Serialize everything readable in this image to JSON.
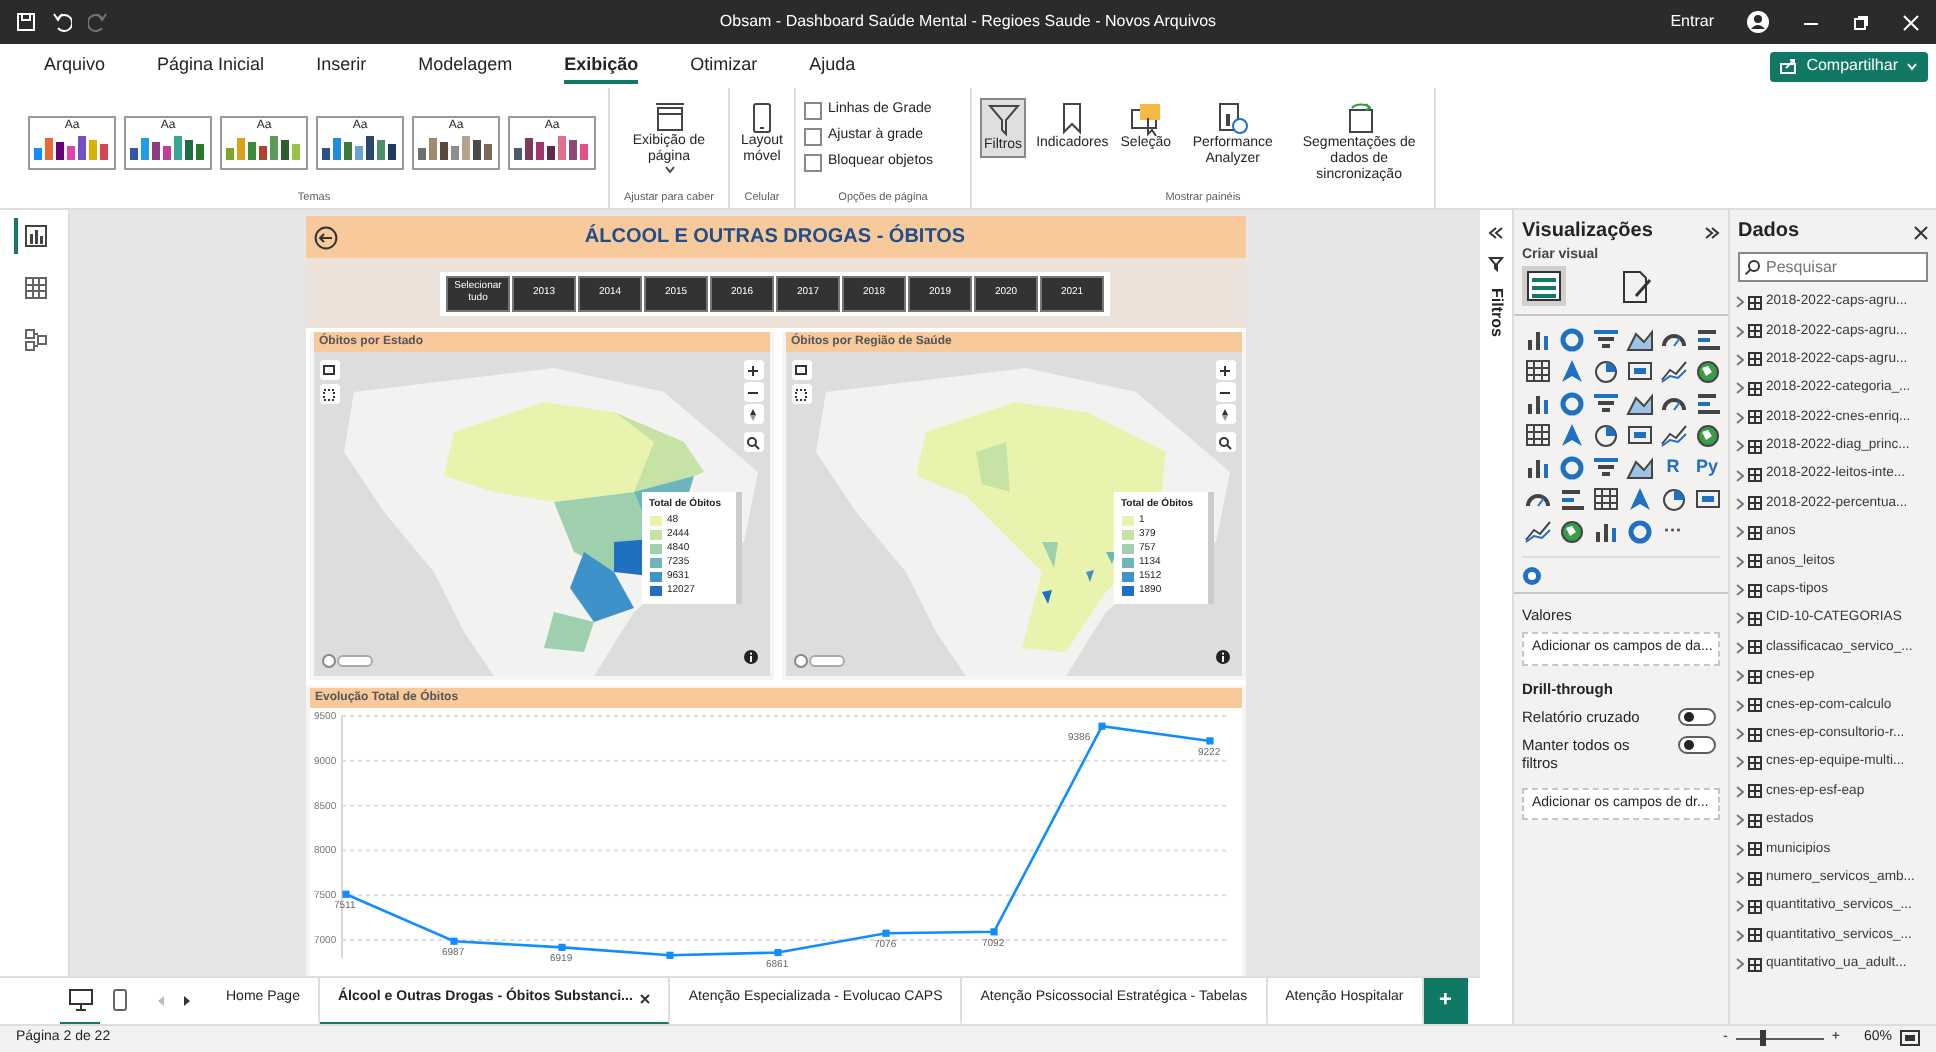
{
  "window": {
    "title": "Obsam - Dashboard Saúde Mental - Regioes Saude - Novos Arquivos",
    "sign_in": "Entrar"
  },
  "ribbon": {
    "tabs": [
      {
        "label": "Arquivo",
        "selected": false
      },
      {
        "label": "Página Inicial",
        "selected": false
      },
      {
        "label": "Inserir",
        "selected": false
      },
      {
        "label": "Modelagem",
        "selected": false
      },
      {
        "label": "Exibição",
        "selected": true
      },
      {
        "label": "Otimizar",
        "selected": false
      },
      {
        "label": "Ajuda",
        "selected": false
      }
    ],
    "share_button": "Compartilhar",
    "themes": {
      "group_label": "Temas",
      "items": [
        {
          "label": "Aa",
          "bars": [
            {
              "color": "#118dff"
            },
            {
              "color": "#e66c37"
            },
            {
              "color": "#6b007b"
            },
            {
              "color": "#e044a7"
            },
            {
              "color": "#744ec2"
            },
            {
              "color": "#d9b300"
            },
            {
              "color": "#d64550"
            }
          ]
        },
        {
          "label": "Aa",
          "bars": [
            {
              "color": "#3257a8"
            },
            {
              "color": "#1f9ce8"
            },
            {
              "color": "#8b3d88"
            },
            {
              "color": "#c23c96"
            },
            {
              "color": "#37a794"
            },
            {
              "color": "#1d6f3f"
            },
            {
              "color": "#2b7a2b"
            }
          ]
        },
        {
          "label": "Aa",
          "bars": [
            {
              "color": "#7aa629"
            },
            {
              "color": "#d9a21b"
            },
            {
              "color": "#3b8c3b"
            },
            {
              "color": "#b04030"
            },
            {
              "color": "#5a9a5a"
            },
            {
              "color": "#2d5f2d"
            },
            {
              "color": "#9ac14a"
            }
          ]
        },
        {
          "label": "Aa",
          "bars": [
            {
              "color": "#2a4f8a"
            },
            {
              "color": "#1f8ce0"
            },
            {
              "color": "#3e7a3e"
            },
            {
              "color": "#68a0d8"
            },
            {
              "color": "#29466b"
            },
            {
              "color": "#4a8f6a"
            },
            {
              "color": "#1b3b5f"
            }
          ]
        },
        {
          "label": "Aa",
          "bars": [
            {
              "color": "#6f6f6f"
            },
            {
              "color": "#a0886e"
            },
            {
              "color": "#5b4a3c"
            },
            {
              "color": "#8e8e8e"
            },
            {
              "color": "#b7a28c"
            },
            {
              "color": "#4a4a4a"
            },
            {
              "color": "#7b6a5a"
            }
          ]
        },
        {
          "label": "Aa",
          "bars": [
            {
              "color": "#4a5b6e"
            },
            {
              "color": "#7a3b5e"
            },
            {
              "color": "#a3356e"
            },
            {
              "color": "#5c2a4a"
            },
            {
              "color": "#e07090"
            },
            {
              "color": "#8a4a7a"
            },
            {
              "color": "#e0508a"
            }
          ]
        }
      ]
    },
    "page_view": {
      "label": "Exibição de página",
      "group_label": "Ajustar para caber"
    },
    "mobile": {
      "label": "Layout móvel",
      "group_label": "Celular"
    },
    "page_options": {
      "group_label": "Opções de página",
      "items": [
        {
          "label": "Linhas de Grade",
          "checked": false
        },
        {
          "label": "Ajustar à grade",
          "checked": false
        },
        {
          "label": "Bloquear objetos",
          "checked": false
        }
      ]
    },
    "panels": {
      "group_label": "Mostrar painéis",
      "items": [
        {
          "label": "Filtros",
          "selected": true
        },
        {
          "label": "Indicadores",
          "selected": false
        },
        {
          "label": "Seleção",
          "selected": false
        },
        {
          "label": "Performance Analyzer",
          "selected": false
        },
        {
          "label": "Segmentações de dados de sincronização",
          "selected": false
        }
      ]
    }
  },
  "left_rail": {
    "views": [
      {
        "selected": true
      },
      {
        "selected": false
      },
      {
        "selected": false
      }
    ]
  },
  "report": {
    "title": "ÁLCOOL E OUTRAS DROGAS - ÓBITOS",
    "year_slicer": [
      "Selecionar tudo",
      "2013",
      "2014",
      "2015",
      "2016",
      "2017",
      "2018",
      "2019",
      "2020",
      "2021"
    ],
    "maps": [
      {
        "title": "Óbitos por Estado",
        "legend": {
          "title": "Total de Óbitos",
          "items": [
            {
              "label": "48",
              "color": "#e9f3ad"
            },
            {
              "label": "2444",
              "color": "#c6e2a5"
            },
            {
              "label": "4840",
              "color": "#9fd0ae"
            },
            {
              "label": "7235",
              "color": "#6db4bb"
            },
            {
              "label": "9631",
              "color": "#3f92c9"
            },
            {
              "label": "12027",
              "color": "#1f70c1"
            }
          ]
        }
      },
      {
        "title": "Óbitos por Região de Saúde",
        "legend": {
          "title": "Total de Óbitos",
          "items": [
            {
              "label": "1",
              "color": "#e9f3ad"
            },
            {
              "label": "379",
              "color": "#c6e2a5"
            },
            {
              "label": "757",
              "color": "#9fd0ae"
            },
            {
              "label": "1134",
              "color": "#6db4bb"
            },
            {
              "label": "1512",
              "color": "#3f92c9"
            },
            {
              "label": "1890",
              "color": "#1f70c1"
            }
          ]
        }
      }
    ],
    "line_chart": {
      "chart_data": {
        "type": "line",
        "title": "Evolução Total de Óbitos",
        "ylim": [
          6800,
          9500
        ],
        "grid": true,
        "yticks": [
          7000,
          7500,
          8000,
          8500,
          9000,
          9500
        ],
        "series": [
          {
            "color": "#118dff",
            "marker": "square",
            "values": [
              7511,
              6987,
              6919,
              6830,
              6861,
              7076,
              7092,
              9386,
              9222
            ]
          }
        ],
        "value_labels": [
          "7511",
          "6987",
          "6919",
          null,
          "6861",
          "7076",
          "7092",
          "9386",
          "9222"
        ]
      }
    }
  },
  "filters_pane": {
    "label": "Filtros"
  },
  "visualizations": {
    "title": "Visualizações",
    "subtitle": "Criar visual",
    "modes": [
      {
        "selected": true
      },
      {
        "selected": false
      }
    ],
    "gallery_texts": [
      "R",
      "Py",
      "···"
    ],
    "values_label": "Valores",
    "values_well": "Adicionar os campos de da...",
    "drill_through": "Drill-through",
    "toggles": [
      {
        "label": "Relatório cruzado",
        "on": false
      },
      {
        "label": "Manter todos os filtros",
        "on": false
      }
    ],
    "drill_well": "Adicionar os campos de dr..."
  },
  "data": {
    "title": "Dados",
    "search": {
      "placeholder": "Pesquisar"
    },
    "tables": [
      "2018-2022-caps-agru...",
      "2018-2022-caps-agru...",
      "2018-2022-caps-agru...",
      "2018-2022-categoria_...",
      "2018-2022-cnes-enriq...",
      "2018-2022-diag_princ...",
      "2018-2022-leitos-inte...",
      "2018-2022-percentua...",
      "anos",
      "anos_leitos",
      "caps-tipos",
      "CID-10-CATEGORIAS",
      "classificacao_servico_...",
      "cnes-ep",
      "cnes-ep-com-calculo",
      "cnes-ep-consultorio-r...",
      "cnes-ep-equipe-multi...",
      "cnes-ep-esf-eap",
      "estados",
      "municipios",
      "numero_servicos_amb...",
      "quantitativo_servicos_...",
      "quantitativo_servicos_...",
      "quantitativo_ua_adult..."
    ]
  },
  "page_tabs": {
    "views": [
      {
        "selected": true
      },
      {
        "selected": false
      }
    ],
    "pages": [
      {
        "label": "Home Page",
        "selected": false
      },
      {
        "label": "Álcool e Outras Drogas - Óbitos Substanci...",
        "selected": true
      },
      {
        "label": "Atenção Especializada - Evolucao CAPS",
        "selected": false
      },
      {
        "label": "Atenção Psicossocial Estratégica - Tabelas",
        "selected": false
      },
      {
        "label": "Atenção Hospitalar",
        "selected": false
      }
    ],
    "add": "+"
  },
  "status_bar": {
    "page": "Página 2 de 22",
    "zoom": {
      "minus": "-",
      "plus": "+",
      "level": 0.3,
      "reading": "60%"
    }
  }
}
